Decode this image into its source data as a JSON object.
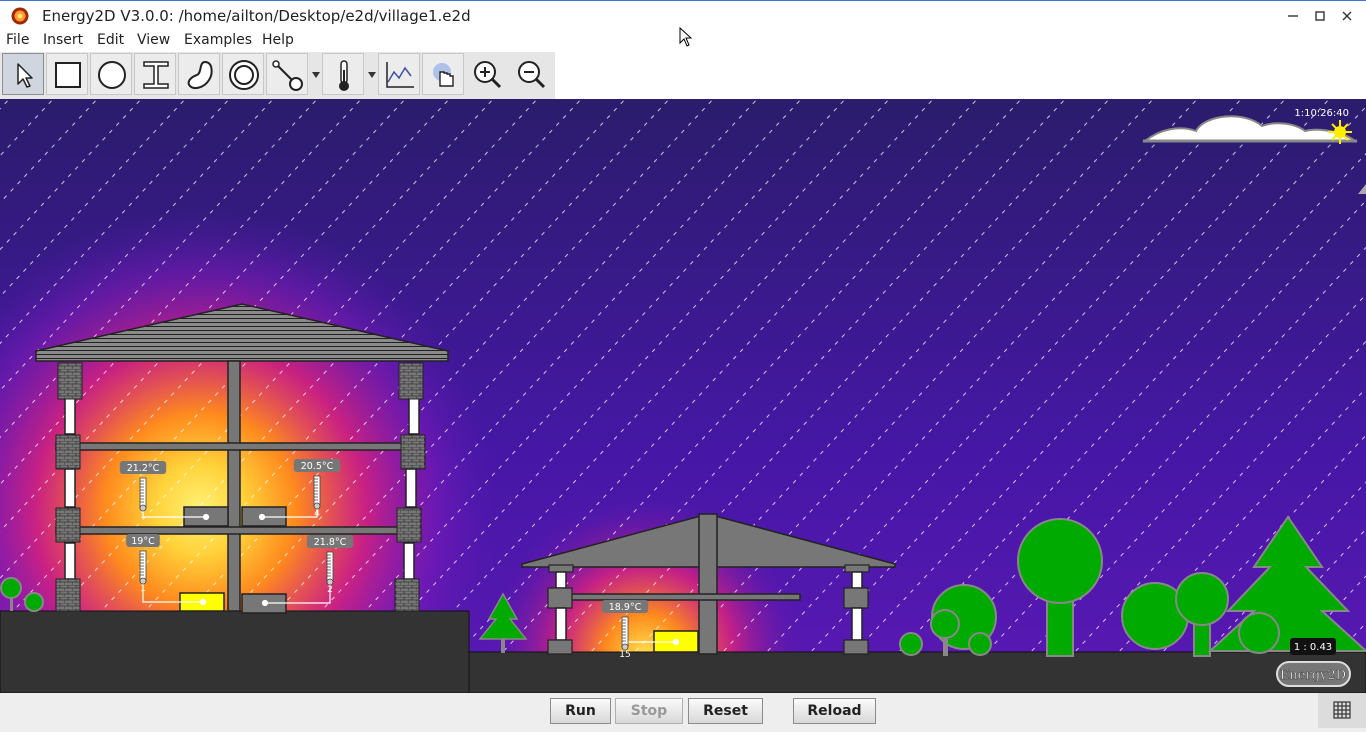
{
  "window": {
    "title": "Energy2D V3.0.0: /home/ailton/Desktop/e2d/village1.e2d"
  },
  "menu": [
    "File",
    "Insert",
    "Edit",
    "View",
    "Examples",
    "Help"
  ],
  "toolbar": {
    "tools": [
      "select-arrow",
      "rectangle",
      "ellipse",
      "i-beam",
      "blob",
      "annulus",
      "fan-particle",
      "thermometer",
      "graph",
      "heating",
      "zoom-in",
      "zoom-out"
    ],
    "selected": "select-arrow"
  },
  "scene": {
    "clock": "1:10:26:40",
    "view_scale": "1 : 0.43",
    "brand": "Energy2D",
    "thermometers": [
      {
        "reading": "21.2°C",
        "id": "1"
      },
      {
        "reading": "20.5°C",
        "id": "4"
      },
      {
        "reading": "19°C",
        "id": "1"
      },
      {
        "reading": "21.8°C",
        "id": "2"
      },
      {
        "reading": "18.9°C",
        "id": "15"
      }
    ]
  },
  "controls": {
    "run": "Run",
    "stop": "Stop",
    "reset": "Reset",
    "reload": "Reload"
  },
  "colors": {
    "sky_top": "#2a1a6e",
    "sky_mid": "#4a1ab0",
    "heat_core": "#ffe55a",
    "tree": "#00aa00",
    "ground": "#333333",
    "heater": "#ffff00"
  }
}
